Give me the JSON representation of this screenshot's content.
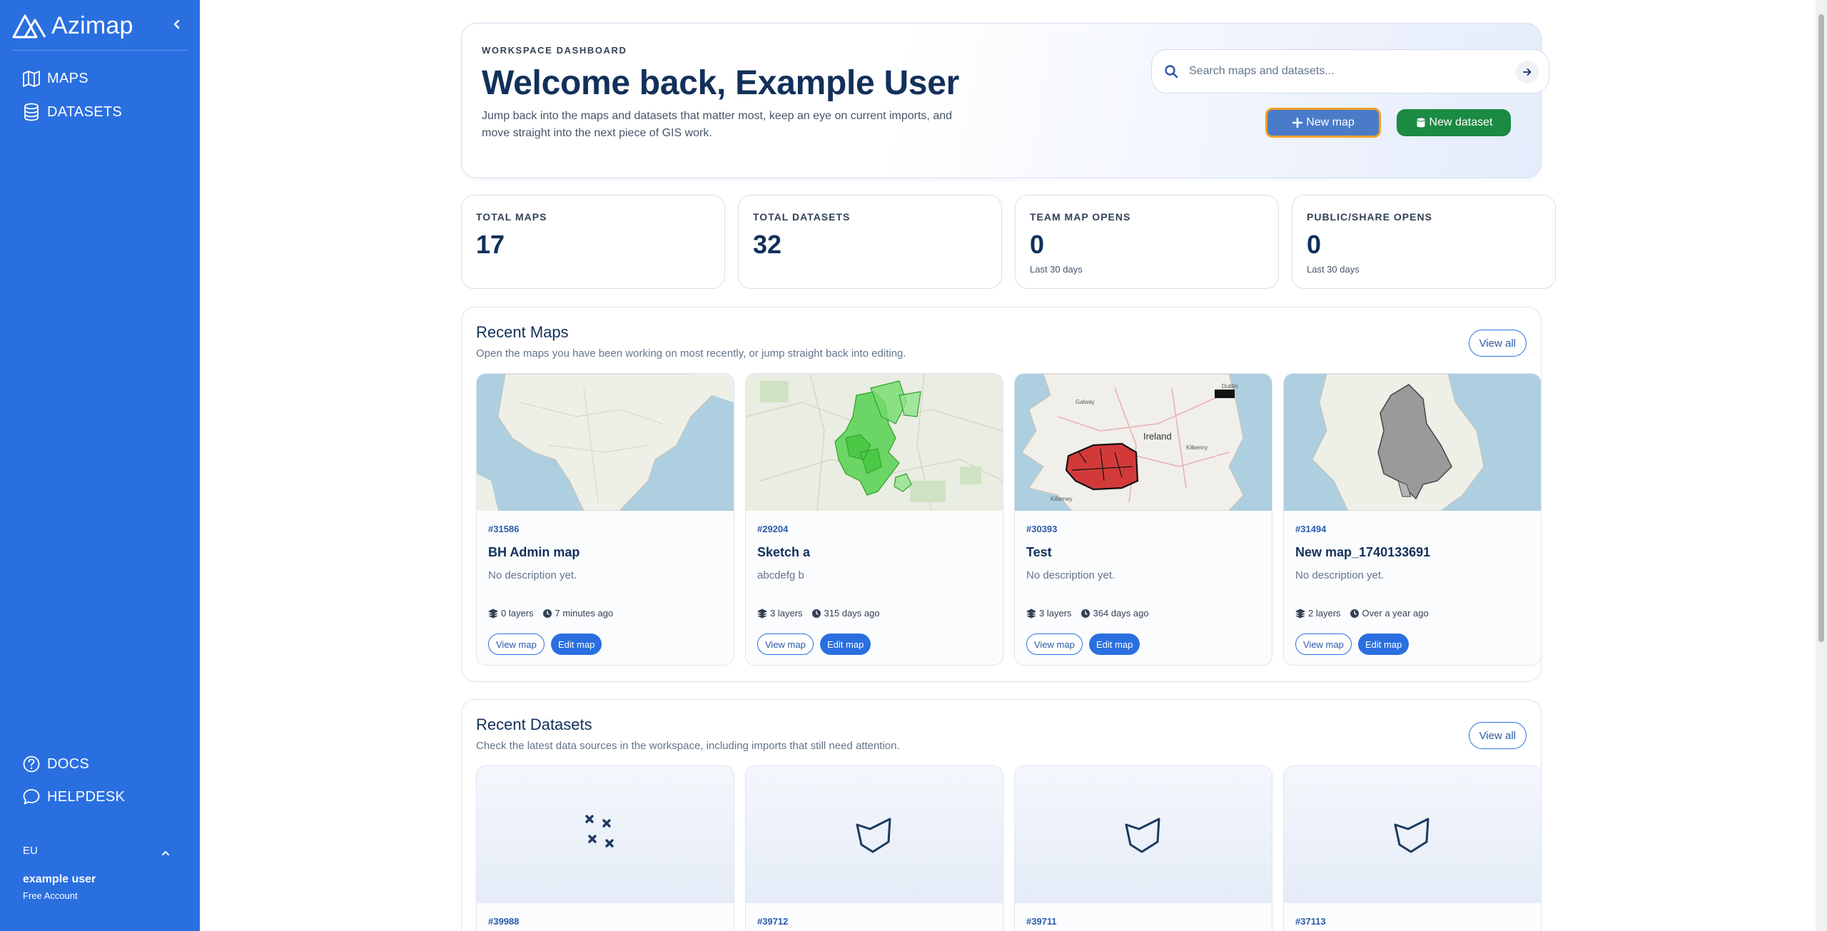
{
  "sidebar": {
    "brand": "Azimap",
    "nav": [
      {
        "label": "MAPS",
        "icon": "map-icon"
      },
      {
        "label": "DATASETS",
        "icon": "database-icon"
      }
    ],
    "bottom_nav": [
      {
        "label": "DOCS",
        "icon": "help-circle-icon"
      },
      {
        "label": "HELPDESK",
        "icon": "chat-bubble-icon"
      }
    ],
    "region": "EU",
    "user_name": "example user",
    "user_plan": "Free Account"
  },
  "hero": {
    "eyebrow": "WORKSPACE DASHBOARD",
    "title": "Welcome back, Example User",
    "description": "Jump back into the maps and datasets that matter most, keep an eye on current imports, and move straight into the next piece of GIS work.",
    "search_placeholder": "Search maps and datasets...",
    "new_map_label": "New map",
    "new_dataset_label": "New dataset"
  },
  "stats": [
    {
      "label": "TOTAL MAPS",
      "value": "17",
      "sub": ""
    },
    {
      "label": "TOTAL DATASETS",
      "value": "32",
      "sub": ""
    },
    {
      "label": "TEAM MAP OPENS",
      "value": "0",
      "sub": "Last 30 days"
    },
    {
      "label": "PUBLIC/SHARE OPENS",
      "value": "0",
      "sub": "Last 30 days"
    }
  ],
  "recent_maps": {
    "title": "Recent Maps",
    "subtitle": "Open the maps you have been working on most recently, or jump straight back into editing.",
    "view_all": "View all",
    "cards": [
      {
        "id": "#31586",
        "title": "BH Admin map",
        "description": "No description yet.",
        "layers": "0 layers",
        "time": "7 minutes ago",
        "view": "View map",
        "edit": "Edit map"
      },
      {
        "id": "#29204",
        "title": "Sketch a",
        "description": "abcdefg b",
        "layers": "3 layers",
        "time": "315 days ago",
        "view": "View map",
        "edit": "Edit map"
      },
      {
        "id": "#30393",
        "title": "Test",
        "description": "No description yet.",
        "layers": "3 layers",
        "time": "364 days ago",
        "view": "View map",
        "edit": "Edit map",
        "map_labels": [
          "Ireland",
          "Galway",
          "Dublin",
          "Kilkenny",
          "Killarney"
        ]
      },
      {
        "id": "#31494",
        "title": "New map_1740133691",
        "description": "No description yet.",
        "layers": "2 layers",
        "time": "Over a year ago",
        "view": "View map",
        "edit": "Edit map"
      }
    ]
  },
  "recent_datasets": {
    "title": "Recent Datasets",
    "subtitle": "Check the latest data sources in the workspace, including imports that still need attention.",
    "view_all": "View all",
    "cards": [
      {
        "id": "#39988",
        "icon": "points-icon"
      },
      {
        "id": "#39712",
        "icon": "polygon-icon"
      },
      {
        "id": "#39711",
        "icon": "polygon-icon"
      },
      {
        "id": "#37113",
        "icon": "polygon-icon"
      }
    ]
  },
  "colors": {
    "sidebar": "#2a6fe0",
    "primary_dark": "#12305a",
    "new_dataset": "#1b8a43",
    "focus_ring": "#f0a02a"
  }
}
